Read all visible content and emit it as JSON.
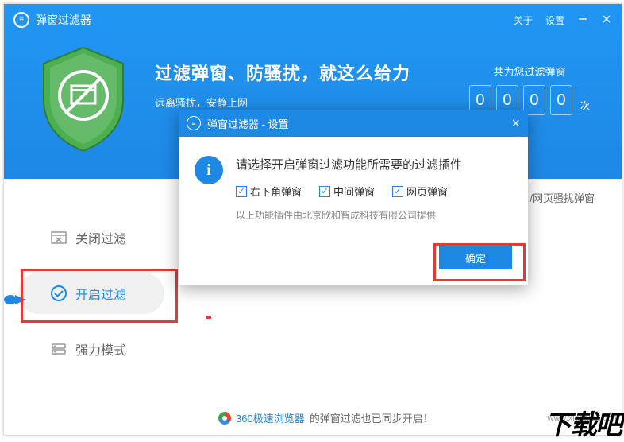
{
  "app": {
    "title": "弹窗过滤器",
    "about": "关于",
    "settings": "设置"
  },
  "hero": {
    "title": "过滤弹窗、防骚扰，就这么给力",
    "subtitle": "远离骚扰，安静上网"
  },
  "counter": {
    "label": "共为您过滤弹窗",
    "digits": [
      "0",
      "0",
      "0",
      "0"
    ],
    "unit": "次"
  },
  "sidebar": {
    "items": [
      {
        "label": "关闭过滤"
      },
      {
        "label": "开启过滤"
      },
      {
        "label": "强力模式"
      }
    ]
  },
  "right_text": "/网页骚扰弹窗",
  "sync": {
    "browser": "360极速浏览器",
    "tail": "的弹窗过滤也已同步开启！"
  },
  "dialog": {
    "title": "弹窗过滤器 - 设置",
    "heading": "请选择开启弹窗过滤功能所需要的过滤插件",
    "checks": [
      {
        "label": "右下角弹窗",
        "checked": true
      },
      {
        "label": "中间弹窗",
        "checked": true
      },
      {
        "label": "网页弹窗",
        "checked": true
      }
    ],
    "note": "以上功能插件由北京欣和智成科技有限公司提供",
    "ok": "确定"
  },
  "watermark": {
    "url": "www.xiazaiba.com",
    "text": "下载吧"
  }
}
